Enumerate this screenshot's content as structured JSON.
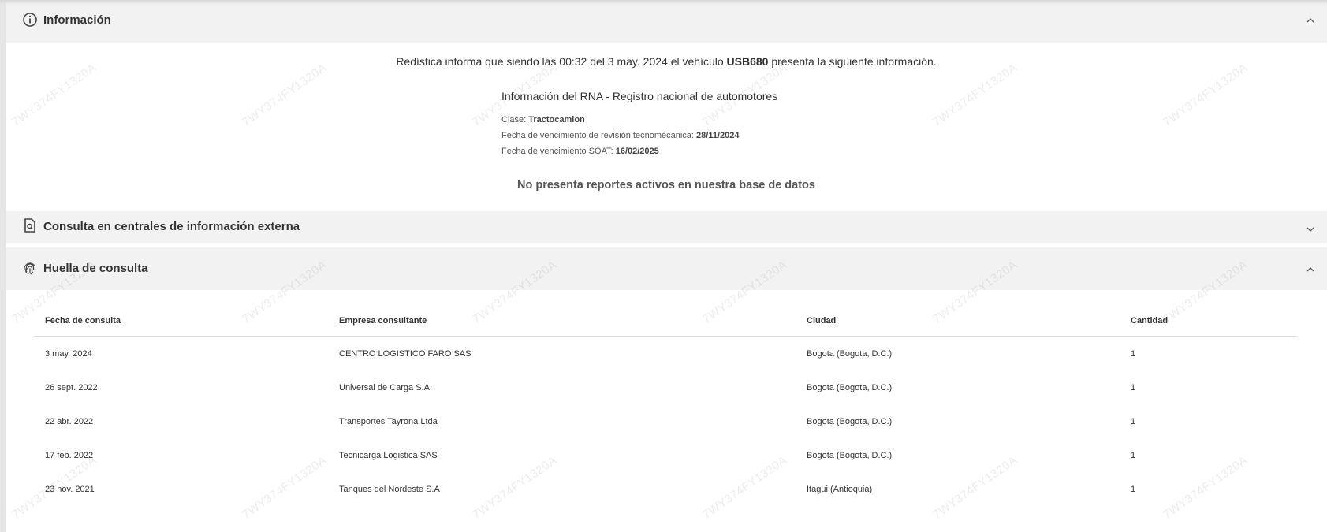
{
  "informacion": {
    "title": "Información",
    "summary_before": "Redística informa que siendo las 00:32 del 3 may. 2024 el vehículo ",
    "plate": "USB680",
    "summary_after": " presenta la siguiente información.",
    "rna_title": "Información del RNA - Registro nacional de automotores",
    "clase_label": "Clase: ",
    "clase_value": "Tractocamion",
    "tecno_label": "Fecha de vencimiento de revisión tecnomécanica: ",
    "tecno_value": "28/11/2024",
    "soat_label": "Fecha de vencimiento SOAT: ",
    "soat_value": "16/02/2025",
    "no_reports": "No presenta reportes activos en nuestra base de datos"
  },
  "consulta_externa": {
    "title": "Consulta en centrales de información externa"
  },
  "huella": {
    "title": "Huella de consulta",
    "columns": [
      "Fecha de consulta",
      "Empresa consultante",
      "Ciudad",
      "Cantidad"
    ],
    "rows": [
      {
        "fecha": "3 may. 2024",
        "empresa": "CENTRO LOGISTICO FARO SAS",
        "ciudad": "Bogota (Bogota, D.C.)",
        "cantidad": "1"
      },
      {
        "fecha": "26 sept. 2022",
        "empresa": "Universal de Carga S.A.",
        "ciudad": "Bogota (Bogota, D.C.)",
        "cantidad": "1"
      },
      {
        "fecha": "22 abr. 2022",
        "empresa": "Transportes Tayrona Ltda",
        "ciudad": "Bogota (Bogota, D.C.)",
        "cantidad": "1"
      },
      {
        "fecha": "17 feb. 2022",
        "empresa": "Tecnicarga Logistica SAS",
        "ciudad": "Bogota (Bogota, D.C.)",
        "cantidad": "1"
      },
      {
        "fecha": "23 nov. 2021",
        "empresa": "Tanques del Nordeste S.A",
        "ciudad": "Itagui (Antioquia)",
        "cantidad": "1"
      }
    ]
  },
  "watermark": "7WY374FY1320A",
  "icons": {
    "info": "info-circle-icon",
    "consulta": "document-search-icon",
    "huella": "fingerprint-icon",
    "collapse": "chevron-up-icon",
    "expand": "chevron-down-icon"
  },
  "colors": {
    "header_bg": "#f2f2f2",
    "text": "#333333",
    "muted": "#555555"
  }
}
